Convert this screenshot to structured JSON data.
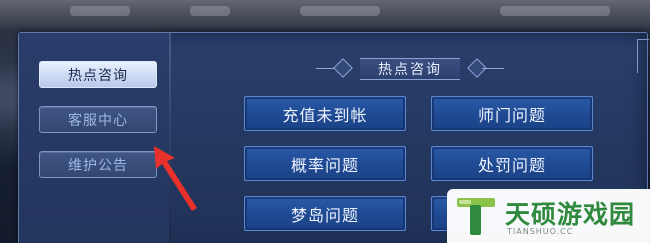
{
  "sidebar": {
    "items": [
      {
        "label": "热点咨询",
        "active": true
      },
      {
        "label": "客服中心",
        "active": false
      },
      {
        "label": "维护公告",
        "active": false
      }
    ]
  },
  "main": {
    "section_title": "热点咨询",
    "topics": [
      {
        "label": "充值未到帐"
      },
      {
        "label": "师门问题"
      },
      {
        "label": "概率问题"
      },
      {
        "label": "处罚问题"
      },
      {
        "label": "梦岛问题"
      },
      {
        "label": ""
      }
    ]
  },
  "annotation": {
    "color": "#e8312b",
    "shape": "arrow"
  },
  "watermark": {
    "title": "天硕游戏园",
    "url": "TIANSHUO.CC",
    "brand_color": "#2f8a3e",
    "accent_color": "#8bc34a"
  }
}
